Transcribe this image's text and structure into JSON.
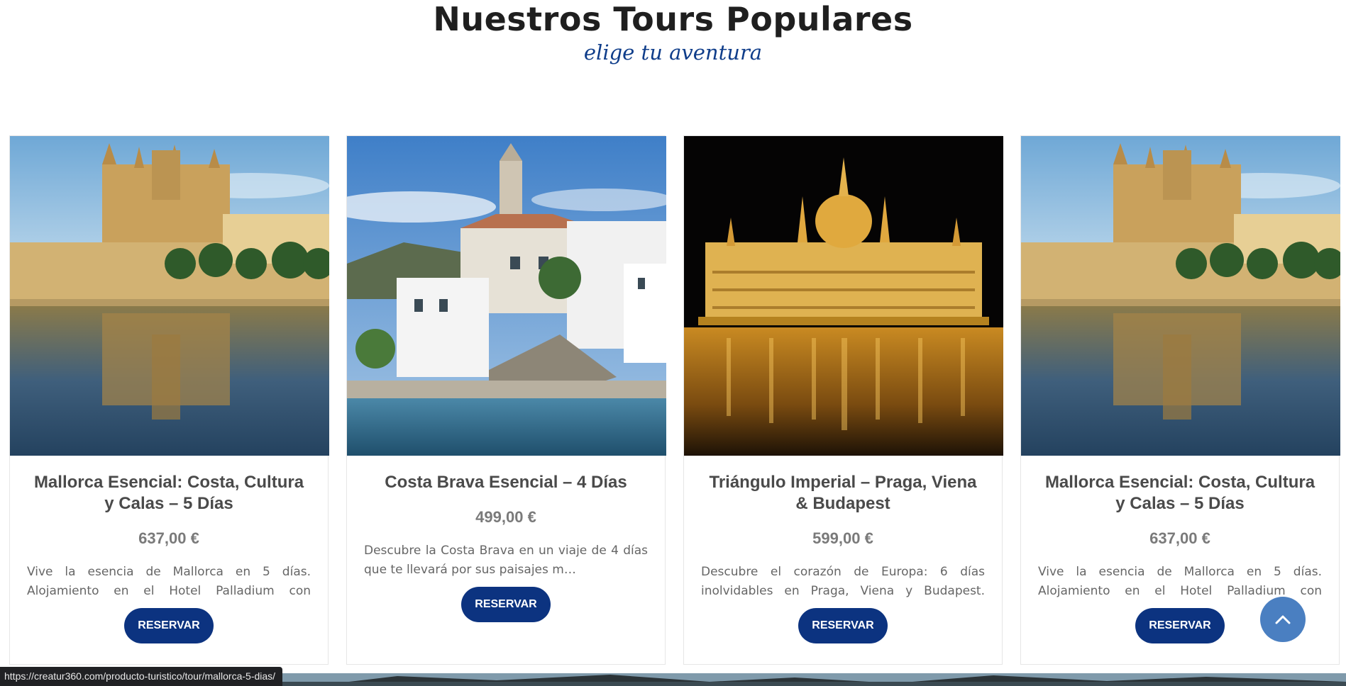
{
  "section": {
    "title": "Nuestros Tours Populares",
    "subtitle": "elige tu aventura"
  },
  "tours": [
    {
      "title": "Mallorca Esencial: Costa, Cultura y Calas – 5 Días",
      "price": "637,00 €",
      "description": "Vive la esencia de Mallorca en 5 días. Alojamiento en el Hotel Palladium con desayun…",
      "button": "RESERVAR",
      "image": "palma-cathedral-photo"
    },
    {
      "title": "Costa Brava Esencial – 4 Días",
      "price": "499,00 €",
      "description": "Descubre la Costa Brava en un viaje de 4 días que te llevará por sus paisajes m…",
      "button": "RESERVAR",
      "image": "cadaques-village-photo"
    },
    {
      "title": "Triángulo Imperial – Praga, Viena & Budapest",
      "price": "599,00 €",
      "description": "Descubre el corazón de Europa: 6 días inolvidables en Praga, Viena y Budapest. Inclu…",
      "button": "RESERVAR",
      "image": "budapest-parliament-night-photo"
    },
    {
      "title": "Mallorca Esencial: Costa, Cultura y Calas – 5 Días",
      "price": "637,00 €",
      "description": "Vive la esencia de Mallorca en 5 días. Alojamiento en el Hotel Palladium con desayun…",
      "button": "RESERVAR",
      "image": "palma-cathedral-photo"
    }
  ],
  "scroll_top": {
    "icon": "chevron-up-icon"
  },
  "status_bar": {
    "url": "https://creatur360.com/producto-turistico/tour/mallorca-5-dias/"
  },
  "colors": {
    "accent": "#0c3380",
    "subtitle": "#0f3d8a",
    "scroll_button": "#4a7fc1",
    "status_bg": "#202124"
  }
}
